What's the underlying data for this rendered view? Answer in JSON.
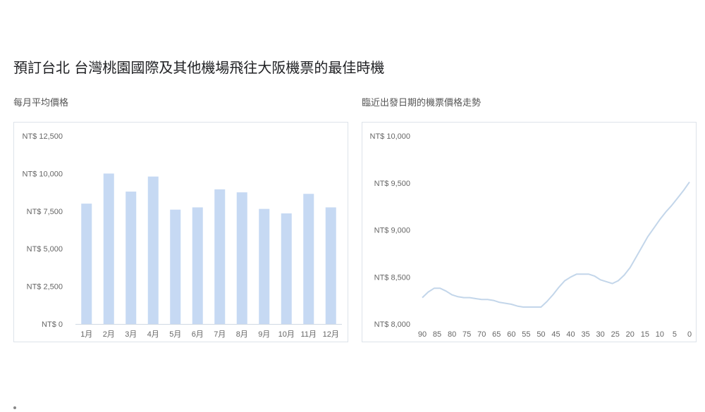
{
  "page": {
    "title": "預訂台北 台灣桃園國際及其他機場飛往大阪機票的最佳時機"
  },
  "chart_data": [
    {
      "type": "bar",
      "title": "每月平均價格",
      "categories": [
        "1月",
        "2月",
        "3月",
        "4月",
        "5月",
        "6月",
        "7月",
        "8月",
        "9月",
        "10月",
        "11月",
        "12月"
      ],
      "values": [
        8000,
        10000,
        8800,
        9800,
        7600,
        7750,
        8950,
        8750,
        7650,
        7350,
        8650,
        7750
      ],
      "y_ticks": [
        "NT$ 0",
        "NT$ 2,500",
        "NT$ 5,000",
        "NT$ 7,500",
        "NT$ 10,000",
        "NT$ 12,500"
      ],
      "y_tick_values": [
        0,
        2500,
        5000,
        7500,
        10000,
        12500
      ],
      "ylim": [
        0,
        12500
      ],
      "color": "#c6d9f3",
      "grid": false
    },
    {
      "type": "line",
      "title": "臨近出發日期的機票價格走勢",
      "x_ticks": [
        "90",
        "85",
        "80",
        "75",
        "70",
        "65",
        "60",
        "55",
        "50",
        "45",
        "40",
        "35",
        "30",
        "25",
        "20",
        "15",
        "10",
        "5",
        "0"
      ],
      "y_ticks": [
        "NT$ 8,000",
        "NT$ 8,500",
        "NT$ 9,000",
        "NT$ 9,500",
        "NT$ 10,000"
      ],
      "y_tick_values": [
        8000,
        8500,
        9000,
        9500,
        10000
      ],
      "xlim": [
        90,
        0
      ],
      "ylim": [
        8000,
        10000
      ],
      "x": [
        90,
        88,
        86,
        84,
        82,
        80,
        78,
        76,
        74,
        72,
        70,
        68,
        66,
        64,
        62,
        60,
        58,
        56,
        54,
        52,
        50,
        48,
        46,
        44,
        42,
        40,
        38,
        36,
        34,
        32,
        30,
        28,
        26,
        24,
        22,
        20,
        18,
        16,
        14,
        12,
        10,
        8,
        6,
        4,
        2,
        0
      ],
      "values": [
        8280,
        8340,
        8380,
        8380,
        8350,
        8310,
        8290,
        8280,
        8280,
        8270,
        8260,
        8260,
        8250,
        8230,
        8220,
        8210,
        8190,
        8180,
        8180,
        8180,
        8180,
        8240,
        8310,
        8390,
        8460,
        8500,
        8530,
        8530,
        8530,
        8510,
        8470,
        8450,
        8430,
        8460,
        8520,
        8600,
        8710,
        8820,
        8930,
        9020,
        9110,
        9190,
        9260,
        9340,
        9420,
        9510
      ],
      "color": "#c3d6ea",
      "grid": false
    }
  ]
}
